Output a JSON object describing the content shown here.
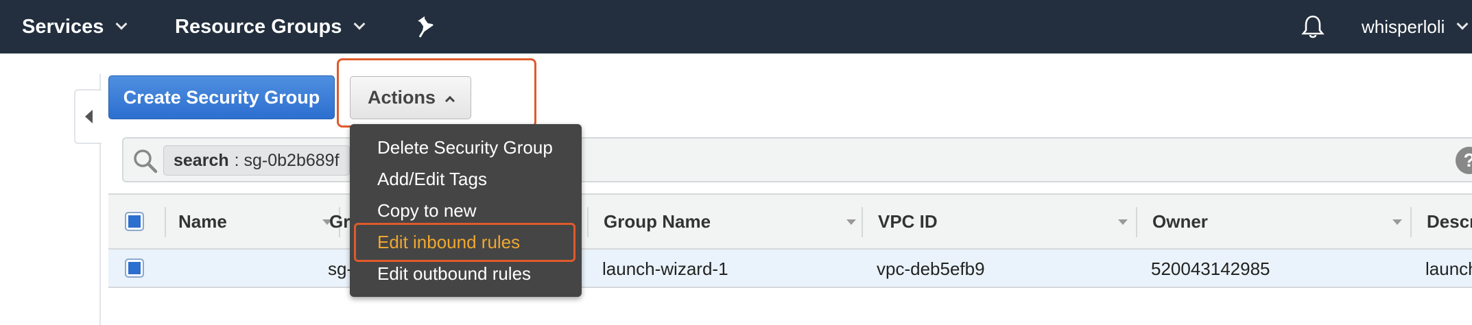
{
  "nav": {
    "services": "Services",
    "resource_groups": "Resource Groups",
    "user": "whisperloli",
    "icons": [
      "pin-icon",
      "bell-icon"
    ]
  },
  "toolbar": {
    "create_label": "Create Security Group",
    "actions_label": "Actions"
  },
  "search": {
    "key": "search",
    "value": ": sg-0b2b689f"
  },
  "table": {
    "columns": [
      "Name",
      "Gr",
      "Group Name",
      "VPC ID",
      "Owner",
      "Descr"
    ],
    "rows": [
      {
        "name": "",
        "group_id": "sg-",
        "group_name": "launch-wizard-1",
        "vpc_id": "vpc-deb5efb9",
        "owner": "520043142985",
        "description": "launch"
      }
    ]
  },
  "actions_menu": {
    "items": [
      "Delete Security Group",
      "Add/Edit Tags",
      "Copy to new",
      "Edit inbound rules",
      "Edit outbound rules"
    ],
    "highlighted": "Edit inbound rules"
  },
  "colors": {
    "topbar": "#232f3e",
    "primary_button": "#2c6fcf",
    "highlight_border": "#e05a2b",
    "menu_active_text": "#f0a830"
  }
}
